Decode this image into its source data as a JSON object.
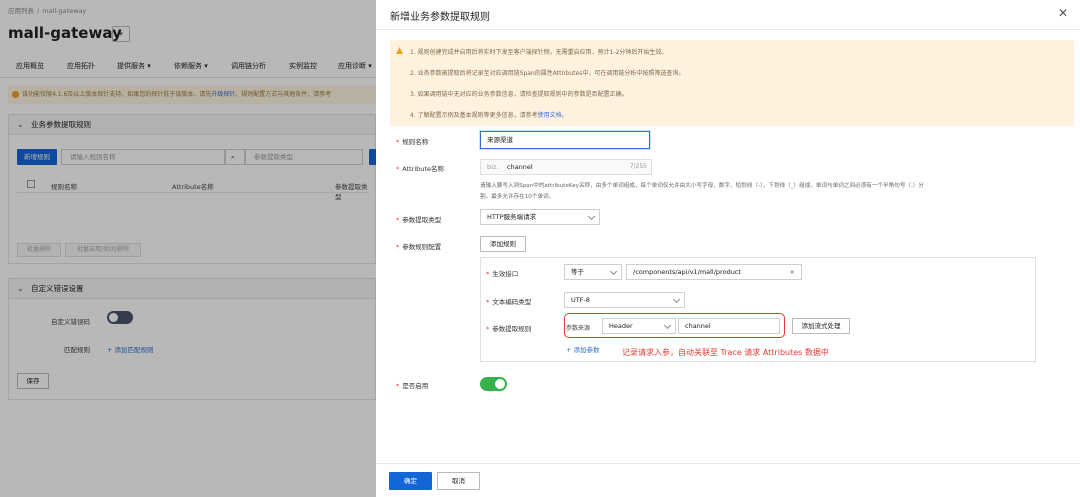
{
  "background": {
    "breadcrumb": {
      "parent": "应用列表",
      "separator": "/",
      "current": "mall-gateway"
    },
    "app_name": "mall-gateway",
    "app_switch_caret": "▾",
    "nav_items": [
      "应用概览",
      "应用拓扑",
      "提供服务 ▾",
      "依赖服务 ▾",
      "调用链分析",
      "实例监控",
      "应用诊断 ▾"
    ],
    "warning_text_a": "该功能仅限4.1.6及以上版本探针支持，如果您的探针低于该版本，请先",
    "warning_link": "升级探针",
    "warning_text_b": "。规则配置方式与其他条件，请参考",
    "section1": {
      "title": "业务参数提取规则",
      "new_button": "新增规则",
      "search_placeholder": "请输入规则名称",
      "filter_placeholder": "参数提取类型",
      "columns": [
        "规则名称",
        "Attribute名称",
        "参数提取类型"
      ],
      "batch_delete": "批量删除",
      "batch_toggle": "批量启用/关闭/删除"
    },
    "section2": {
      "title": "自定义错误设置",
      "custom_error_label": "自定义错误码",
      "match_rule_label": "匹配规则",
      "add_match_rule": "+ 添加匹配规则",
      "save_button": "保存"
    }
  },
  "drawer": {
    "title": "新增业务参数提取规则",
    "close": "✕",
    "notice": [
      {
        "text": "1. 规则创建完成并启用后将实时下发至客户端探针侧，无需重启应用，预计1-2分钟后开始生效。"
      },
      {
        "text": "2. 业务参数被提取后将记录至对应调用链Span的属性Attributes中，可在调用链分析中按照筛选查询。"
      },
      {
        "text": "3. 如果调用链中无对应的业务参数信息，请检查提取规则中的参数是否配置正确。"
      },
      {
        "text": "4. 了解配置示例及基本规则等更多信息，请参考",
        "link": "使用文档",
        "tail": "。"
      }
    ],
    "rule_name_label": "规则名称",
    "rule_name_value": "来源渠道",
    "attr_label": "Attribute名称",
    "attr_prefix": "biz.",
    "attr_value": "channel",
    "attr_count": "7/255",
    "attr_help_1": "请输入要写入到Span中的attributeKey名称，由多个单词组成，每个单词仅允许由大小写字母、数字、短划线（-）、下划线（_）组成，单词与单词之间必须有一个半角句号（.）分",
    "attr_help_2": "割。最多允许存在10个单词。",
    "type_label": "参数提取类型",
    "type_value": "HTTP服务端请求",
    "config_label": "参数规则配置",
    "add_rule_button": "添加规则",
    "interface_label": "生效接口",
    "interface_op": "等于",
    "interface_value": "/components/api/v1/mall/product",
    "interface_clear": "×",
    "encoding_label": "文本编码类型",
    "encoding_value": "UTF-8",
    "extract_label": "参数提取规则",
    "source_prefix": "参数来源",
    "source_value": "Header",
    "param_value": "channel",
    "add_stream_button": "添加流式处理",
    "add_param": "+ 添加参数",
    "annotation": "记录请求入参，自动关联至 Trace 请求 Attributes 数据中",
    "enable_label": "是否启用",
    "ok_button": "确定",
    "cancel_button": "取消"
  }
}
